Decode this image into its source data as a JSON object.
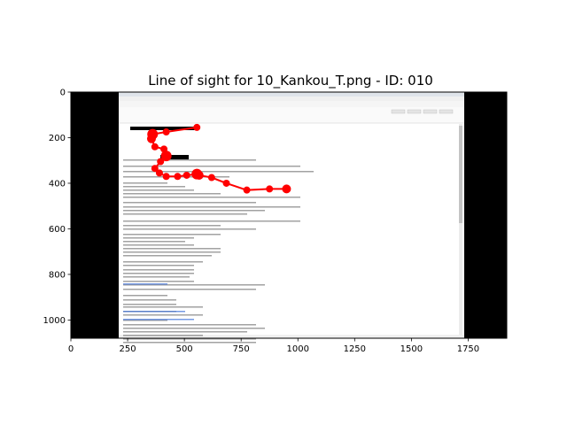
{
  "chart_data": {
    "type": "scatter",
    "title": "Line of sight for 10_Kankou_T.png - ID: 010",
    "xlabel": "",
    "ylabel": "",
    "xlim": [
      0,
      1920
    ],
    "ylim": [
      1080,
      0
    ],
    "y_inverted": true,
    "xticks": [
      0,
      250,
      500,
      750,
      1000,
      1250,
      1500,
      1750
    ],
    "yticks": [
      0,
      200,
      400,
      600,
      800,
      1000
    ],
    "background_image": "email screenshot (Mozilla Thunderbird, Japanese text)",
    "grid": false,
    "series": [
      {
        "color": "#ff0000",
        "x": [
          555,
          420,
          360,
          355,
          370,
          410,
          420,
          395,
          370,
          390,
          420,
          470,
          510,
          555,
          565,
          620,
          685,
          775,
          875,
          950
        ],
        "y": [
          155,
          175,
          185,
          205,
          240,
          250,
          280,
          305,
          335,
          355,
          370,
          370,
          365,
          360,
          365,
          375,
          400,
          430,
          425,
          425
        ],
        "sizes": [
          4,
          4,
          6,
          5,
          4,
          4,
          6,
          4,
          4,
          4,
          4,
          4,
          4,
          6,
          5,
          4,
          4,
          4,
          4,
          5
        ]
      }
    ]
  }
}
